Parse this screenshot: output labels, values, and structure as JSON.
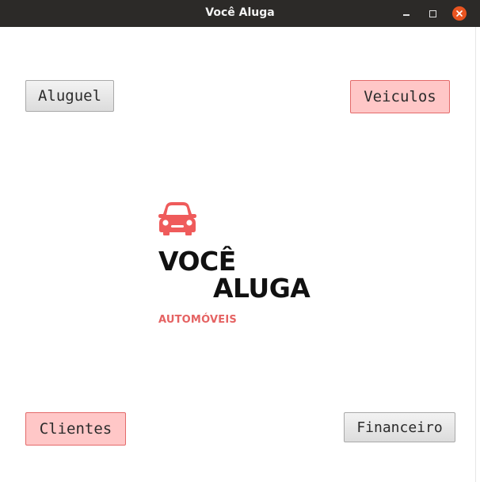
{
  "window": {
    "title": "Você Aluga"
  },
  "buttons": {
    "aluguel": "Aluguel",
    "veiculos": "Veiculos",
    "clientes": "Clientes",
    "financeiro": "Financeiro"
  },
  "logo": {
    "line1": "VOCÊ",
    "line2": "ALUGA",
    "subtitle": "AUTOMÓVEIS",
    "icon": "car-icon",
    "accent_color": "#ef5b5b"
  },
  "colors": {
    "titlebar": "#2c2a28",
    "close_button": "#e95420",
    "pink_button_bg": "#ffc7c7",
    "pink_button_border": "#e36a6a",
    "gray_button_bg": "#e6e6e6"
  }
}
